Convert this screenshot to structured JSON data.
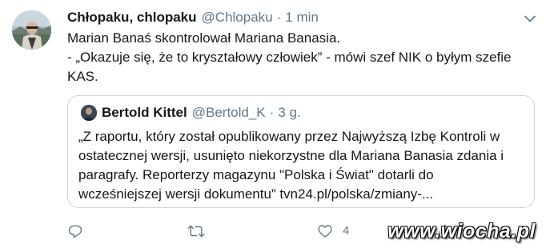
{
  "tweet": {
    "display_name": "Chłopaku, chlopaku",
    "handle": "@Chlopaku",
    "separator": "·",
    "time": "1 min",
    "text_lines": [
      "Marian Banaś skontrolował Mariana Banasia.",
      "- „Okazuje się, że to kryształowy człowiek” - mówi szef NIK o byłym szefie",
      "KAS."
    ]
  },
  "quoted_tweet": {
    "display_name": "Bertold Kittel",
    "handle": "@Bertold_K",
    "separator": "·",
    "time": "3 g.",
    "text_lines": [
      "„Z raportu, który został opublikowany przez Najwyższą Izbę Kontroli w",
      "ostatecznej wersji, usunięto niekorzystne dla Mariana Banasia zdania i",
      "paragrafy. Reporterzy magazynu \"Polska i Świat\" dotarli do",
      "wcześniejszej wersji dokumentu”  tvn24.pl/polska/zmiany-..."
    ]
  },
  "actions": {
    "reply_icon": "reply-icon",
    "retweet_icon": "retweet-icon",
    "like_icon": "heart-icon",
    "like_count": "4",
    "share_icon": "share-icon"
  },
  "watermark": "www.wiocha.pl",
  "colors": {
    "text": "#14171a",
    "secondary": "#657786",
    "border": "#ccd6dd",
    "icon": "#657786"
  }
}
